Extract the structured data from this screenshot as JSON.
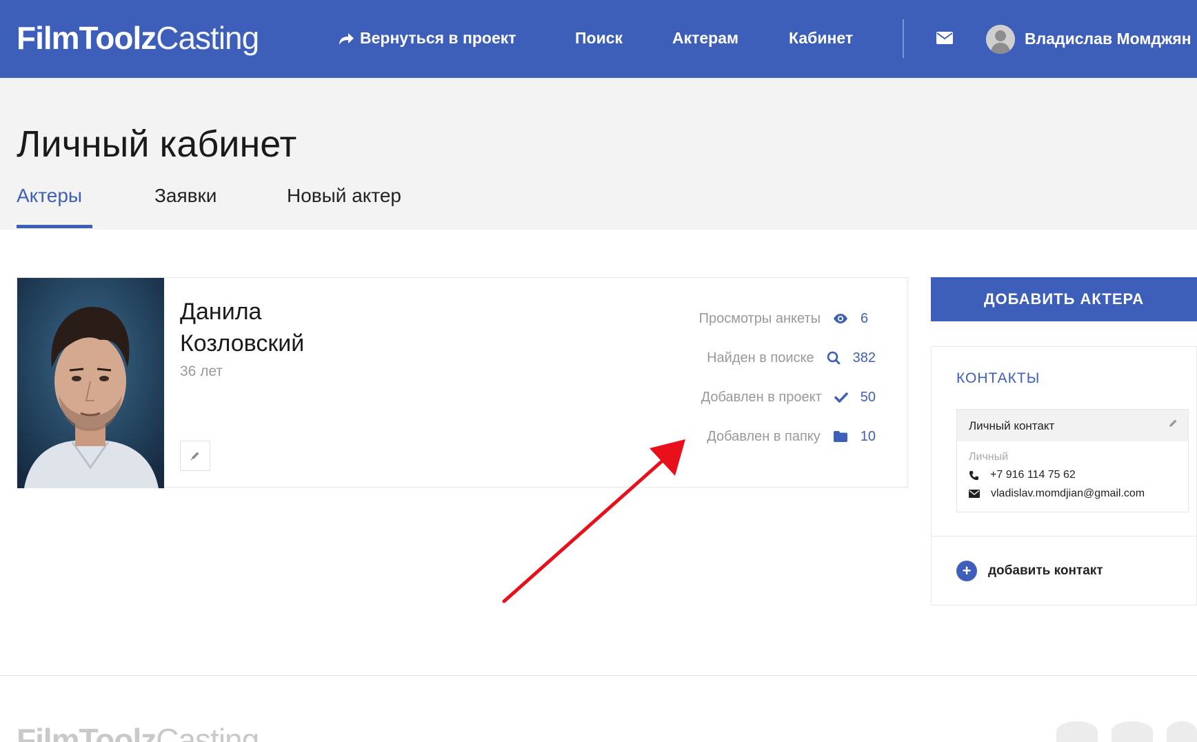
{
  "header": {
    "logo_bold": "FilmToolz",
    "logo_thin": "Casting",
    "back_link": "Вернуться в проект",
    "nav": [
      "Поиск",
      "Актерам",
      "Кабинет"
    ],
    "user_name": "Владислав Момджян"
  },
  "page": {
    "title": "Личный кабинет",
    "tabs": [
      {
        "label": "Актеры",
        "active": true
      },
      {
        "label": "Заявки",
        "active": false
      },
      {
        "label": "Новый актер",
        "active": false
      }
    ]
  },
  "actor": {
    "first_name": "Данила",
    "last_name": "Козловский",
    "age": "36 лет",
    "stats": [
      {
        "label": "Просмотры анкеты",
        "icon": "eye-icon",
        "value": "6"
      },
      {
        "label": "Найден в поиске",
        "icon": "search-icon",
        "value": "382"
      },
      {
        "label": "Добавлен в проект",
        "icon": "check-icon",
        "value": "50"
      },
      {
        "label": "Добавлен в папку",
        "icon": "folder-icon",
        "value": "10"
      }
    ]
  },
  "sidebar": {
    "add_actor_label": "ДОБАВИТЬ АКТЕРА",
    "contacts_title": "КОНТАКТЫ",
    "contact": {
      "title": "Личный контакт",
      "type": "Личный",
      "phone": "+7 916 114 75 62",
      "email": "vladislav.momdjian@gmail.com"
    },
    "add_contact_label": "добавить контакт"
  },
  "colors": {
    "brand": "#3d5fba",
    "annotation_arrow": "#e8101a"
  }
}
